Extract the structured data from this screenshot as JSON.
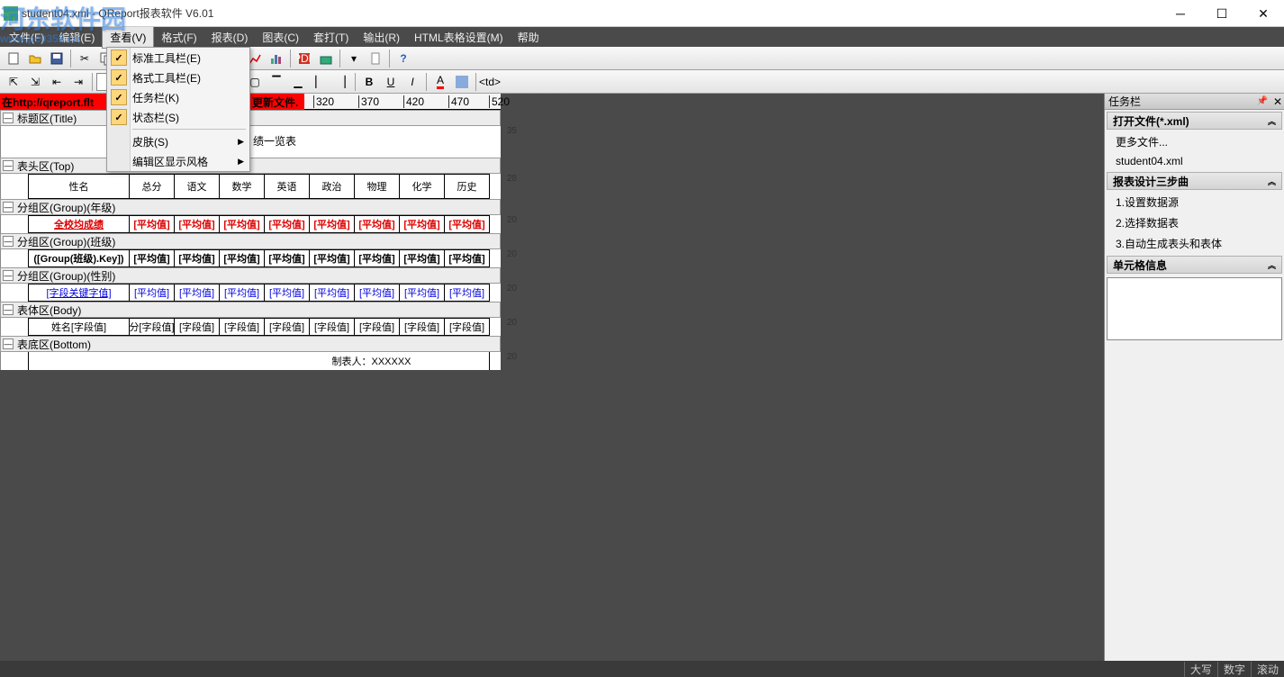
{
  "window": {
    "title": "student04.xml - QReport报表软件 V6.01"
  },
  "watermark": {
    "text": "河东软件园",
    "url": "www.pc0359.cn"
  },
  "menu": {
    "items": [
      "文件(F)",
      "编辑(E)",
      "查看(V)",
      "格式(F)",
      "报表(D)",
      "图表(C)",
      "套打(T)",
      "输出(R)",
      "HTML表格设置(M)",
      "帮助"
    ],
    "active_index": 2
  },
  "dropdown_view": {
    "items": [
      {
        "label": "标准工具栏(E)",
        "checked": true
      },
      {
        "label": "格式工具栏(E)",
        "checked": true
      },
      {
        "label": "任务栏(K)",
        "checked": true
      },
      {
        "label": "状态栏(S)",
        "checked": true
      },
      {
        "label": "皮肤(S)",
        "submenu": true
      },
      {
        "label": "编辑区显示风格",
        "submenu": true
      }
    ]
  },
  "redbar_left": "在http://qreport.flt",
  "redbar_right": "更新文件.",
  "ruler_ticks": [
    "320",
    "370",
    "420",
    "470",
    "520"
  ],
  "sections": {
    "title": {
      "label": "标题区(Title)",
      "h": "35",
      "content": "绩一览表"
    },
    "top": {
      "label": "表头区(Top)",
      "h": "28",
      "cells": [
        "性名",
        "总分",
        "语文",
        "数学",
        "英语",
        "政治",
        "物理",
        "化学",
        "历史"
      ]
    },
    "group1": {
      "label": "分组区(Group)(年级)",
      "h": "20",
      "first": "全校均成绩",
      "cells": [
        "[平均值]",
        "[平均值]",
        "[平均值]",
        "[平均值]",
        "[平均值]",
        "[平均值]",
        "[平均值]",
        "[平均值]"
      ]
    },
    "group2": {
      "label": "分组区(Group)(班级)",
      "h": "20",
      "first": "([Group(班级).Key])",
      "cells": [
        "[平均值]",
        "[平均值]",
        "[平均值]",
        "[平均值]",
        "[平均值]",
        "[平均值]",
        "[平均值]",
        "[平均值]"
      ]
    },
    "group3": {
      "label": "分组区(Group)(性别)",
      "h": "20",
      "first": "[字段关键字值]",
      "cells": [
        "[平均值]",
        "[平均值]",
        "[平均值]",
        "[平均值]",
        "[平均值]",
        "[平均值]",
        "[平均值]",
        "[平均值]"
      ]
    },
    "body": {
      "label": "表体区(Body)",
      "h": "20",
      "first": "姓名[字段值]",
      "cells": [
        "分[字段值]",
        "[字段值]",
        "[字段值]",
        "[字段值]",
        "[字段值]",
        "[字段值]",
        "[字段值]",
        "[字段值]"
      ]
    },
    "bottom": {
      "label": "表底区(Bottom)",
      "h": "20",
      "content": "制表人：XXXXXX"
    }
  },
  "taskpane": {
    "title": "任务栏",
    "group1": {
      "title": "打开文件(*.xml)",
      "items": [
        "更多文件...",
        "student04.xml"
      ]
    },
    "group2": {
      "title": "报表设计三步曲",
      "items": [
        "1.设置数据源",
        "2.选择数据表",
        "3.自动生成表头和表体"
      ]
    },
    "group3": {
      "title": "单元格信息"
    }
  },
  "status": {
    "items": [
      "大写",
      "数字",
      "滚动"
    ]
  }
}
